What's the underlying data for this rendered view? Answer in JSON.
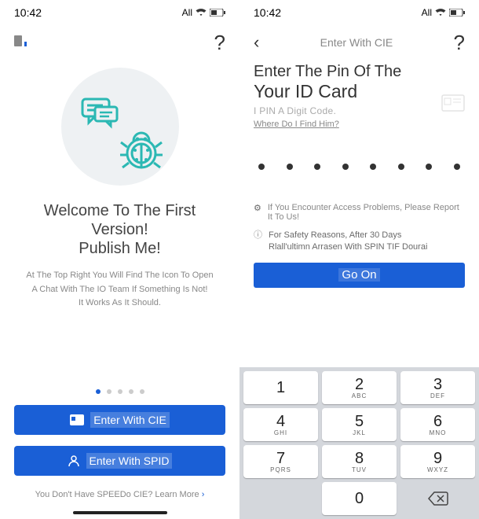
{
  "status": {
    "time": "10:42",
    "net": "All"
  },
  "left": {
    "title_line1": "Welcome To The First Version!",
    "title_line2": "Publish Me!",
    "body_line1": "At The Top Right You Will Find The Icon To Open",
    "body_line2": "A Chat With The IO Team If Something Is Not!",
    "body_line3": "It Works As It Should.",
    "btn_cie": "Enter With CIE",
    "btn_spid": "Enter With SPID",
    "footer": "You Don't Have SPEEDo CIE? Learn More",
    "footer_arrow": "›"
  },
  "right": {
    "header": "Enter With CIE",
    "title_line1": "Enter The Pin Of The",
    "title_line2": "Your ID Card",
    "hint1": "I PIN A Digit Code.",
    "hint2": "Where Do I Find Him?",
    "info": "If You Encounter Access Problems, Please Report It To Us!",
    "safety_line1": "For Safety Reasons, After 30 Days",
    "safety_line2": "Rlall'ultimn Arrasen With SPIN TIF Dourai",
    "go": "Go On",
    "keypad": {
      "k1": {
        "n": "1",
        "l": ""
      },
      "k2": {
        "n": "2",
        "l": "ABC"
      },
      "k3": {
        "n": "3",
        "l": "DEF"
      },
      "k4": {
        "n": "4",
        "l": "GHI"
      },
      "k5": {
        "n": "5",
        "l": "JKL"
      },
      "k6": {
        "n": "6",
        "l": "MNO"
      },
      "k7": {
        "n": "7",
        "l": "PQRS"
      },
      "k8": {
        "n": "8",
        "l": "TUV"
      },
      "k9": {
        "n": "9",
        "l": "WXYZ"
      },
      "k0": {
        "n": "0",
        "l": ""
      }
    }
  }
}
